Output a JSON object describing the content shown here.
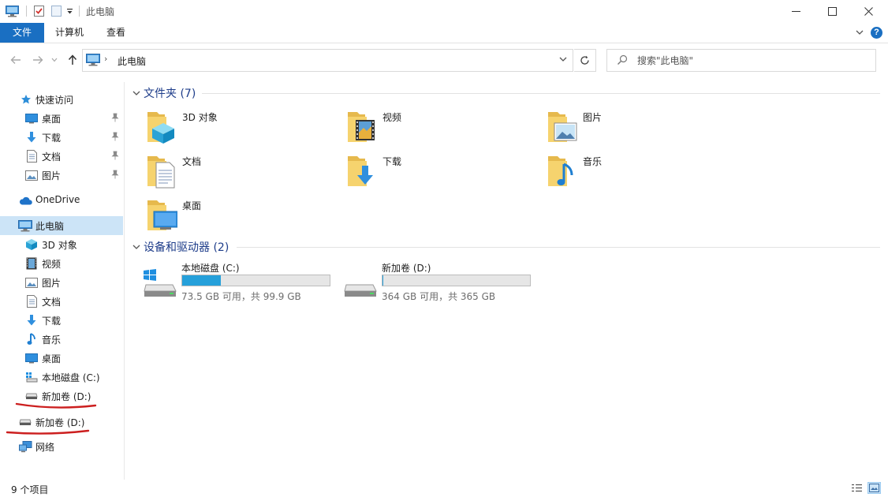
{
  "window": {
    "title": "此电脑",
    "minimize_icon": "minimize-icon",
    "maximize_icon": "maximize-icon",
    "close_icon": "close-icon"
  },
  "ribbon": {
    "tabs": [
      {
        "label": "文件",
        "active": true
      },
      {
        "label": "计算机"
      },
      {
        "label": "查看"
      }
    ],
    "help_label": "?"
  },
  "address": {
    "crumb": "此电脑",
    "separator": "›"
  },
  "search": {
    "placeholder": "搜索\"此电脑\""
  },
  "sidebar": {
    "quick_access": "快速访问",
    "quick_items": [
      {
        "label": "桌面",
        "icon": "desktop-icon"
      },
      {
        "label": "下载",
        "icon": "download-icon"
      },
      {
        "label": "文档",
        "icon": "document-icon"
      },
      {
        "label": "图片",
        "icon": "picture-icon"
      }
    ],
    "onedrive": "OneDrive",
    "this_pc": "此电脑",
    "pc_items": [
      {
        "label": "3D 对象",
        "icon": "3d-object-icon"
      },
      {
        "label": "视频",
        "icon": "video-icon"
      },
      {
        "label": "图片",
        "icon": "picture-icon"
      },
      {
        "label": "文档",
        "icon": "document-icon"
      },
      {
        "label": "下载",
        "icon": "download-icon"
      },
      {
        "label": "音乐",
        "icon": "music-icon"
      },
      {
        "label": "桌面",
        "icon": "desktop-icon"
      },
      {
        "label": "本地磁盘 (C:)",
        "icon": "windows-drive-icon"
      },
      {
        "label": "新加卷 (D:)",
        "icon": "drive-icon"
      }
    ],
    "drive_d": "新加卷 (D:)",
    "network": "网络"
  },
  "content": {
    "folders_header": "文件夹 (7)",
    "folders": [
      {
        "label": "3D 对象",
        "icon": "3d-object-folder-icon"
      },
      {
        "label": "视频",
        "icon": "video-folder-icon"
      },
      {
        "label": "图片",
        "icon": "picture-folder-icon"
      },
      {
        "label": "文档",
        "icon": "document-folder-icon"
      },
      {
        "label": "下载",
        "icon": "download-folder-icon"
      },
      {
        "label": "音乐",
        "icon": "music-folder-icon"
      },
      {
        "label": "桌面",
        "icon": "desktop-folder-icon"
      }
    ],
    "drives_header": "设备和驱动器 (2)",
    "drives": [
      {
        "label": "本地磁盘 (C:)",
        "info": "73.5 GB 可用，共 99.9 GB",
        "used_fraction": 0.264
      },
      {
        "label": "新加卷 (D:)",
        "info": "364 GB 可用，共 365 GB",
        "used_fraction": 0.003
      }
    ]
  },
  "status": {
    "item_count": "9 个项目"
  },
  "colors": {
    "accent": "#1a6fc2",
    "selection": "#cce4f7",
    "capacity_bar": "#26a0da",
    "group_header": "#1e3d8a",
    "annotation": "#cc1f1f"
  }
}
